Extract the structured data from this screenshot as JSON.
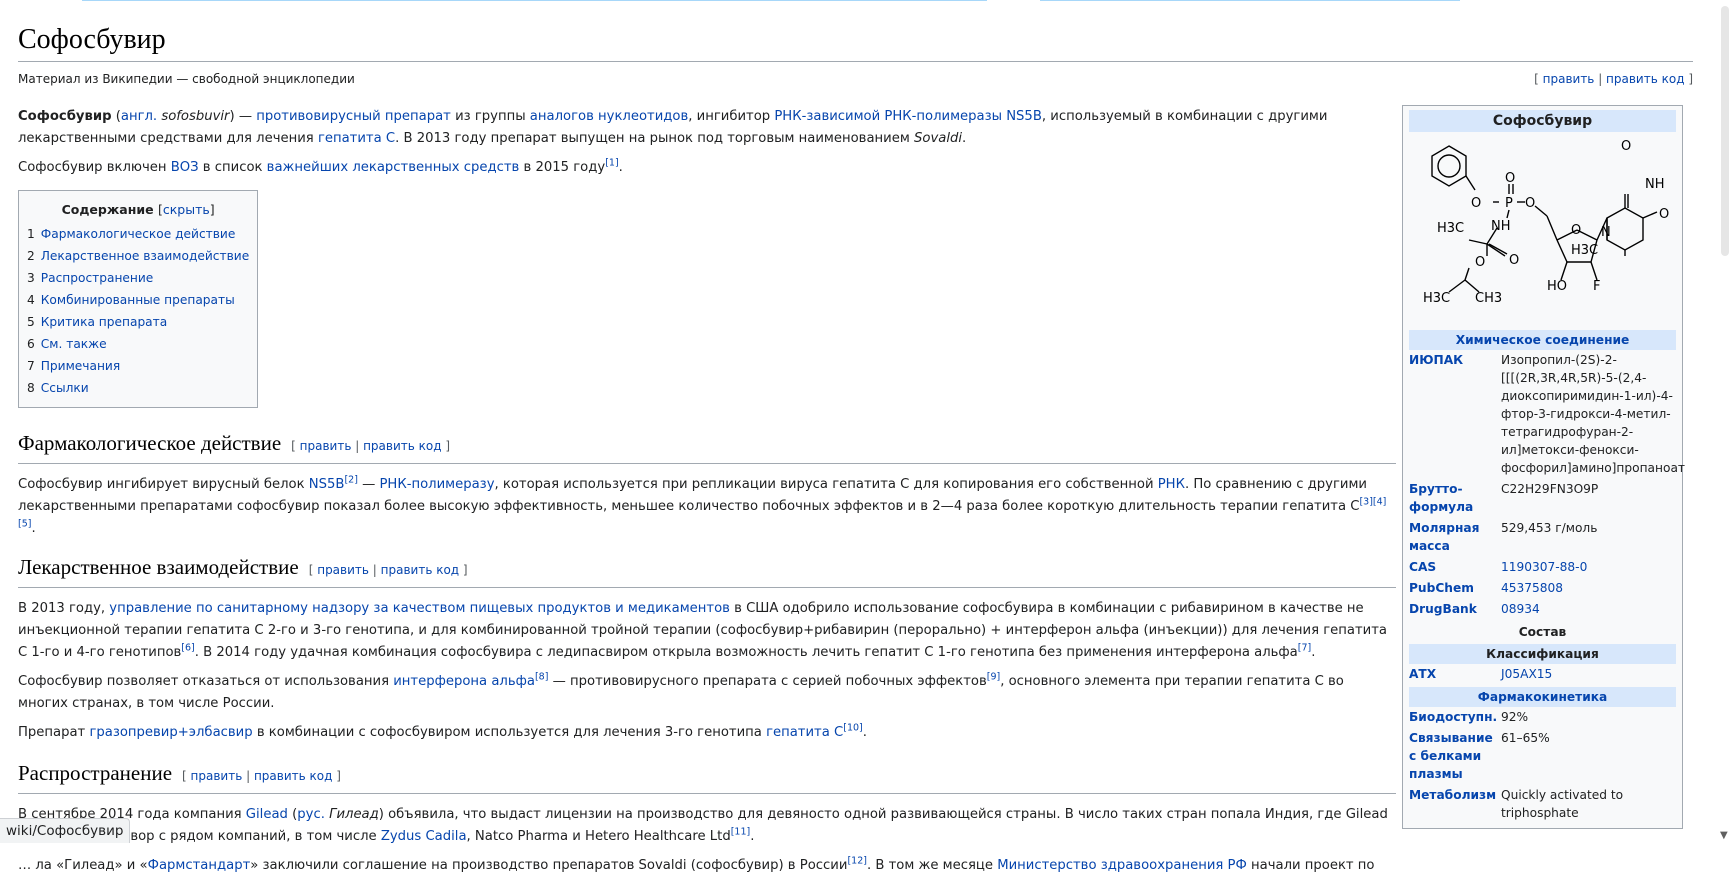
{
  "status_url": "wiki/Софосбувир",
  "page": {
    "title": "Софосбувир",
    "tagline": "Материал из Википедии — свободной энциклопедии",
    "edit": "править",
    "edit_code": "править код"
  },
  "intro": {
    "p1": {
      "bold": "Софосбувир",
      "t1": " (",
      "l1": "англ.",
      "t2": " ",
      "i1": "sofosbuvir",
      "t3": ") — ",
      "l2": "противовирусный препарат",
      "t4": " из группы ",
      "l3": "аналогов нуклеотидов",
      "t5": ", ингибитор ",
      "l4": "РНК-зависимой РНК-полимеразы NS5B",
      "t6": ", используемый в комбинации с другими лекарственными средствами для лечения ",
      "l5": "гепатита C",
      "t7": ". В 2013 году препарат выпущен на рынок под торговым наименованием ",
      "i2": "Sovaldi",
      "t8": "."
    },
    "p2": {
      "t1": "Софосбувир включен ",
      "l1": "ВОЗ",
      "t2": " в список ",
      "l2": "важнейших лекарственных средств",
      "t3": " в 2015 году",
      "s1": "[1]",
      "t4": "."
    }
  },
  "toc": {
    "title": "Содержание",
    "hide": "скрыть",
    "items": [
      {
        "num": "1",
        "label": "Фармакологическое действие"
      },
      {
        "num": "2",
        "label": "Лекарственное взаимодействие"
      },
      {
        "num": "3",
        "label": "Распространение"
      },
      {
        "num": "4",
        "label": "Комбинированные препараты"
      },
      {
        "num": "5",
        "label": "Критика препарата"
      },
      {
        "num": "6",
        "label": "См. также"
      },
      {
        "num": "7",
        "label": "Примечания"
      },
      {
        "num": "8",
        "label": "Ссылки"
      }
    ]
  },
  "sec1": {
    "heading": "Фармакологическое действие",
    "p1": {
      "t1": "Софосбувир ингибирует вирусный белок ",
      "l1": "NS5B",
      "s1": "[2]",
      "t2": " — ",
      "l2": "РНК-полимеразу",
      "t3": ", которая используется при репликации вируса гепатита С для копирования его собственной ",
      "l3": "РНК",
      "t4": ". По сравнению с другими лекарственными препаратами софосбувир показал более высокую эффективность, меньшее количество побочных эффектов и в 2—4 раза более короткую длительность терапии гепатита С",
      "s2": "[3][4][5]",
      "t5": "."
    }
  },
  "sec2": {
    "heading": "Лекарственное взаимодействие",
    "p1": {
      "t1": "В 2013 году, ",
      "l1": "управление по санитарному надзору за качеством пищевых продуктов и медикаментов",
      "t2": " в США одобрило использование софосбувира в комбинации с рибавирином в качестве не инъекционной терапии гепатита С 2-го и 3-го генотипа, и для комбинированной тройной терапии (софосбувир+рибавирин (перорально) + интерферон альфа (инъекции)) для лечения гепатита С 1-го и 4-го генотипов",
      "s1": "[6]",
      "t3": ". В 2014 году удачная комбинация софосбувира с ледипасвиром открыла возможность лечить гепатит С 1-го генотипа без применения интерферона альфа",
      "s2": "[7]",
      "t4": "."
    },
    "p2": {
      "t1": "Софосбувир позволяет отказаться от использования ",
      "l1": "интерферона альфа",
      "s1": "[8]",
      "t2": " — противовирусного препарата с серией побочных эффектов",
      "s2": "[9]",
      "t3": ", основного элемента при терапии гепатита С во многих странах, в том числе России."
    },
    "p3": {
      "t1": "Препарат ",
      "l1": "гразопревир+элбасвир",
      "t2": " в комбинации с софосбувиром используется для лечения 3-го генотипа ",
      "l2": "гепатита С",
      "s1": "[10]",
      "t3": "."
    }
  },
  "sec3": {
    "heading": "Распространение",
    "p1": {
      "t1": "В сентябре 2014 года компания ",
      "l1": "Gilead",
      "t2": " (",
      "l2": "рус.",
      "t3": " ",
      "i1": "Гилеад",
      "t4": ") объявила, что выдаст лицензии на производство для девяносто одной развивающейся страны. В число таких стран попала Индия, где Gilead заключили договор с рядом компаний, в том числе ",
      "l3": "Zydus Cadila",
      "t5": ", Natco Pharma и Hetero Healthcare Ltd",
      "s1": "[11]",
      "t6": "."
    },
    "p2": {
      "t1": "… ла «Гилеад» и «",
      "l1": "Фармстандарт",
      "t2": "» заключили соглашение на производство препаратов Sovaldi (софосбувир) в России",
      "s1": "[12]",
      "t3": ". В том же месяце ",
      "l2": "Министерство здравоохранения РФ",
      "t4": " начали проект по"
    }
  },
  "infobox": {
    "title": "Софосбувир",
    "header_compound": "Химическое соединение",
    "rows": [
      {
        "key": "ИЮПАК",
        "val": "Изопропил-(2S)-2-[[[(2R,3R,4R,5R)-5-(2,4-диоксопиримидин-1-ил)-4-фтор-3-гидрокси-4-метил-тетрагидрофуран-2-ил]метокси-фенокси-фосфорил]амино]пропаноат"
      },
      {
        "key": "Брутто-формула",
        "val": "C22H29FN3O9P"
      },
      {
        "key": "Молярная масса",
        "val": "529,453 г/моль"
      },
      {
        "key": "CAS",
        "val": "1190307-88-0"
      },
      {
        "key": "PubChem",
        "val": "45375808"
      },
      {
        "key": "DrugBank",
        "val": "08934"
      }
    ],
    "header_composition": "Состав",
    "header_classification": "Классификация",
    "atc_key": "АТХ",
    "atc_val": "J05AX15",
    "header_pk": "Фармакокинетика",
    "pk_rows": [
      {
        "key": "Биодоступн.",
        "val": "92%"
      },
      {
        "key": "Связывание с белками плазмы",
        "val": "61–65%"
      },
      {
        "key": "Метаболизм",
        "val": "Quickly activated to triphosphate"
      }
    ],
    "struct_labels": {
      "o1": "O",
      "nh1": "NH",
      "o2": "O",
      "o3": "O",
      "n1": "N",
      "o4": "O",
      "p": "P",
      "o5": "O",
      "o6": "O",
      "nh2": "NH",
      "h3c1": "H3C",
      "h3c2": "H3C",
      "o7": "O",
      "o8": "O",
      "ho": "HO",
      "f": "F",
      "h3c3": "H3C",
      "ch3": "CH3"
    }
  }
}
